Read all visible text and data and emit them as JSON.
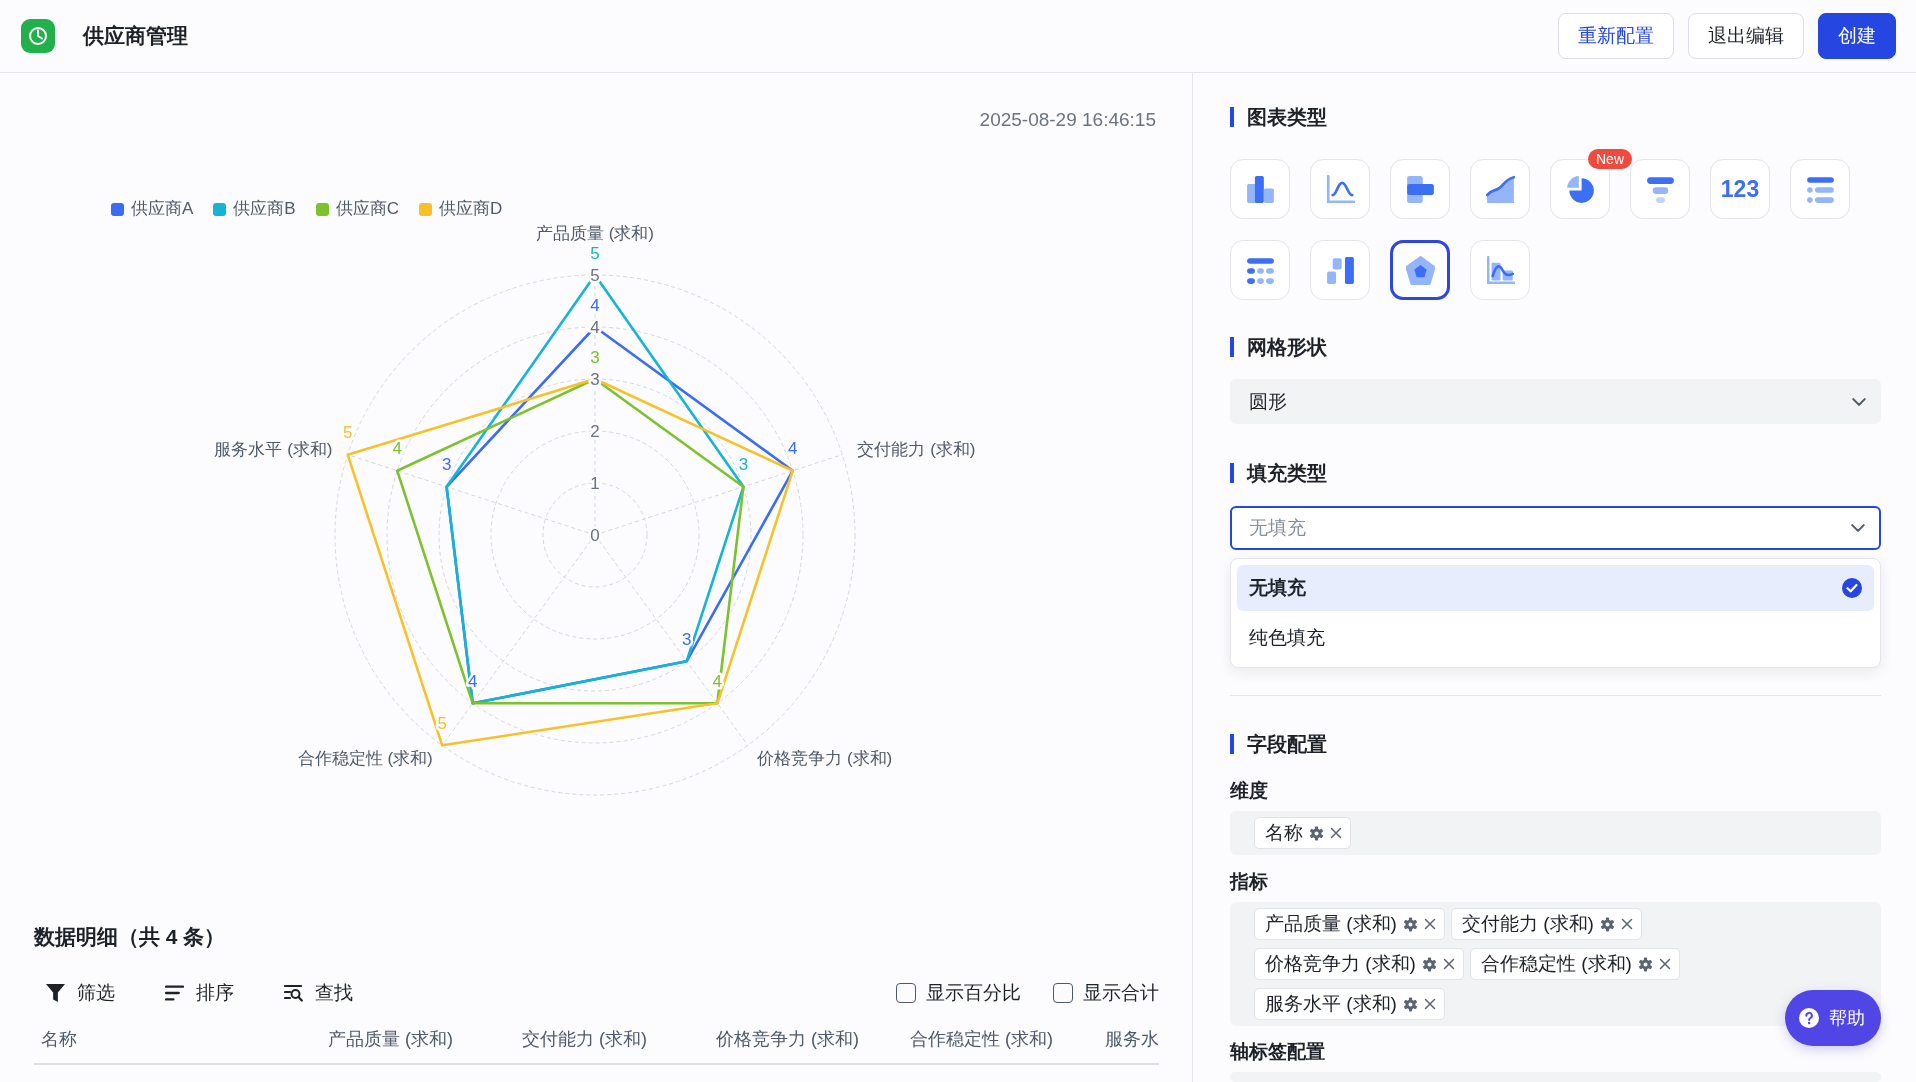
{
  "header": {
    "title": "供应商管理",
    "buttons": [
      {
        "label": "重新配置",
        "kind": "accent"
      },
      {
        "label": "退出编辑",
        "kind": "default"
      },
      {
        "label": "创建",
        "kind": "primary"
      }
    ]
  },
  "chart_panel": {
    "timestamp": "2025-08-29 16:46:15",
    "chart_data": {
      "type": "radar",
      "categories": [
        "产品质量 (求和)",
        "交付能力 (求和)",
        "价格竞争力 (求和)",
        "合作稳定性 (求和)",
        "服务水平 (求和)"
      ],
      "series": [
        {
          "name": "供应商A",
          "color": "#3a6cf4",
          "values": [
            4,
            4,
            3,
            4,
            3
          ],
          "value_labels": [
            "4",
            "4",
            "3",
            "4",
            "3"
          ]
        },
        {
          "name": "供应商B",
          "color": "#16b4d4",
          "values": [
            5,
            3,
            3,
            4,
            3
          ],
          "value_labels": [
            "5",
            "3",
            null,
            null,
            null
          ]
        },
        {
          "name": "供应商C",
          "color": "#7cc22d",
          "values": [
            3,
            3,
            4,
            4,
            4
          ],
          "value_labels": [
            "3",
            null,
            "4",
            null,
            "4"
          ]
        },
        {
          "name": "供应商D",
          "color": "#f8c12a",
          "values": [
            3,
            4,
            4,
            5,
            5
          ],
          "value_labels": [
            null,
            null,
            null,
            "5",
            "5"
          ]
        }
      ],
      "ylim": [
        0,
        5
      ],
      "yticks": [
        0,
        1,
        2,
        3,
        4,
        5
      ]
    }
  },
  "detail": {
    "title": "数据明细（共 4 条）",
    "tools": [
      {
        "label": "筛选",
        "kind": "filter"
      },
      {
        "label": "排序",
        "kind": "sort"
      },
      {
        "label": "查找",
        "kind": "find"
      }
    ],
    "options": [
      {
        "label": "显示百分比",
        "checked": false
      },
      {
        "label": "显示合计",
        "checked": false
      }
    ],
    "columns": [
      "名称",
      "产品质量 (求和)",
      "交付能力 (求和)",
      "价格竞争力 (求和)",
      "合作稳定性 (求和)",
      "服务水"
    ]
  },
  "config_panel": {
    "chart_type": {
      "title": "图表类型",
      "types": [
        {
          "kind": "column",
          "selected": false
        },
        {
          "kind": "line",
          "selected": false
        },
        {
          "kind": "bar",
          "selected": false
        },
        {
          "kind": "area",
          "selected": false
        },
        {
          "kind": "pie",
          "selected": false,
          "badge": "New"
        },
        {
          "kind": "funnel",
          "selected": false
        },
        {
          "kind": "number",
          "label": "123",
          "selected": false
        },
        {
          "kind": "list",
          "selected": false
        },
        {
          "kind": "table",
          "selected": false
        },
        {
          "kind": "waterfall",
          "selected": false
        },
        {
          "kind": "radar",
          "selected": true
        },
        {
          "kind": "combo",
          "selected": false
        }
      ]
    },
    "grid_shape": {
      "title": "网格形状",
      "value": "圆形"
    },
    "fill_type": {
      "title": "填充类型",
      "value": "无填充",
      "expanded": true,
      "options": [
        {
          "label": "无填充",
          "selected": true
        },
        {
          "label": "纯色填充",
          "selected": false
        }
      ]
    },
    "fields": {
      "title": "字段配置",
      "groups": [
        {
          "label": "维度",
          "tags": [
            "名称"
          ]
        },
        {
          "label": "指标",
          "tags": [
            "产品质量 (求和)",
            "交付能力 (求和)",
            "价格竞争力 (求和)",
            "合作稳定性 (求和)",
            "服务水平 (求和)"
          ]
        },
        {
          "label": "轴标签配置"
        }
      ]
    }
  },
  "help_button": {
    "label": "帮助"
  }
}
